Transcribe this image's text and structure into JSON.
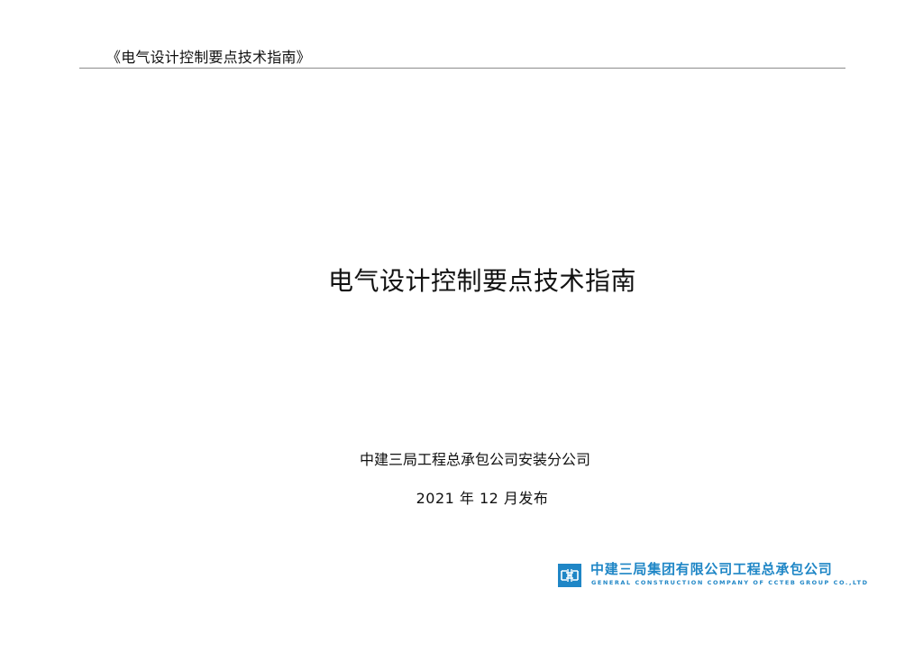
{
  "header": {
    "title": "《电气设计控制要点技术指南》"
  },
  "cover": {
    "title": "电气设计控制要点技术指南",
    "publisher": "中建三局工程总承包公司安装分公司",
    "date": "2021 年 12 月发布"
  },
  "logo": {
    "name_cn": "中建三局集团有限公司工程总承包公司",
    "name_en": "GENERAL CONSTRUCTION COMPANY OF CCTEB GROUP CO.,LTD",
    "brand_color": "#1f86c6"
  }
}
